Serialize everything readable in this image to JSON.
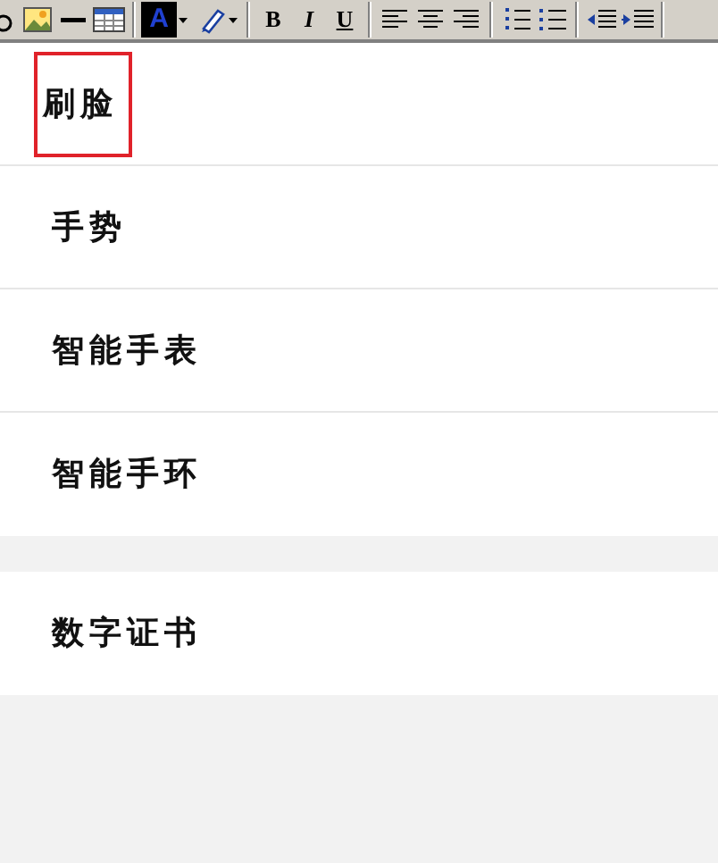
{
  "toolbar": {
    "buttons": [
      {
        "kind": "partial"
      },
      {
        "kind": "image"
      },
      {
        "kind": "rule"
      },
      {
        "kind": "table"
      },
      {
        "kind": "sep"
      },
      {
        "kind": "fontcolor",
        "label": "A"
      },
      {
        "kind": "highlight"
      },
      {
        "kind": "sep"
      },
      {
        "kind": "bold",
        "label": "B"
      },
      {
        "kind": "italic",
        "label": "I"
      },
      {
        "kind": "underline",
        "label": "U"
      },
      {
        "kind": "sep"
      },
      {
        "kind": "alignleft"
      },
      {
        "kind": "aligncenter"
      },
      {
        "kind": "alignright"
      },
      {
        "kind": "sep"
      },
      {
        "kind": "ol"
      },
      {
        "kind": "ul"
      },
      {
        "kind": "sep"
      },
      {
        "kind": "outdent"
      },
      {
        "kind": "indent"
      },
      {
        "kind": "sep"
      }
    ]
  },
  "groups": [
    {
      "items": [
        {
          "label": "刷脸",
          "selected": true
        },
        {
          "label": "手势",
          "selected": false
        },
        {
          "label": "智能手表",
          "selected": false
        },
        {
          "label": "智能手环",
          "selected": false
        }
      ]
    },
    {
      "items": [
        {
          "label": "数字证书",
          "selected": false
        }
      ]
    }
  ]
}
